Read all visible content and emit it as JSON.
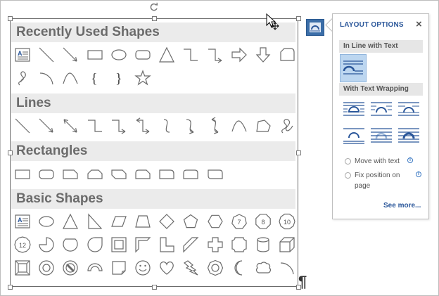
{
  "gallery": {
    "sections": [
      {
        "title": "Recently Used Shapes"
      },
      {
        "title": "Lines"
      },
      {
        "title": "Rectangles"
      },
      {
        "title": "Basic Shapes"
      }
    ],
    "recently_used": [
      "text-box",
      "line",
      "line-arrow",
      "rectangle",
      "oval",
      "rounded-rectangle",
      "triangle",
      "elbow-connector",
      "elbow-arrow-connector",
      "right-arrow",
      "down-arrow",
      "snip-corner",
      "freeform-scribble",
      "arc",
      "curve",
      "left-brace",
      "right-brace",
      "star"
    ],
    "lines": [
      "line",
      "line-arrow",
      "double-arrow-line",
      "elbow-connector",
      "elbow-arrow-connector",
      "elbow-double-arrow",
      "curved-connector",
      "curved-arrow-connector",
      "curved-double-arrow",
      "curve",
      "freeform",
      "scribble"
    ],
    "rectangles": [
      "rectangle",
      "rounded-rectangle",
      "snip-single-corner",
      "snip-same-side",
      "snip-diagonal",
      "snip-round-single",
      "round-single-corner",
      "round-same-side",
      "round-diagonal"
    ],
    "basic_row1": [
      "text-box",
      "oval",
      "triangle",
      "right-triangle",
      "parallelogram",
      "trapezoid",
      "diamond",
      "pentagon",
      "hexagon",
      "heptagon",
      "octagon",
      "decagon"
    ],
    "basic_row1_labels": [
      "",
      "",
      "",
      "",
      "",
      "",
      "",
      "",
      "",
      "7",
      "8",
      "10"
    ],
    "basic_row2": [
      "dodecagon",
      "pie",
      "chord",
      "teardrop",
      "frame",
      "half-frame",
      "l-shape",
      "diagonal-stripe",
      "cross",
      "plaque",
      "can",
      "cube"
    ],
    "basic_row2_labels": [
      "12",
      "",
      "",
      "",
      "",
      "",
      "",
      "",
      "",
      "",
      "",
      ""
    ],
    "basic_row3": [
      "bevel",
      "donut",
      "no-symbol",
      "block-arc",
      "folded-corner",
      "smiley-face",
      "heart",
      "lightning-bolt",
      "sun",
      "moon",
      "cloud",
      "arc"
    ]
  },
  "paragraph_mark": "¶",
  "layout_options": {
    "title": "LAYOUT OPTIONS",
    "close_icon": "×",
    "in_line_label": "In Line with Text",
    "wrapping_label": "With Text Wrapping",
    "wrap_styles": [
      "square",
      "tight",
      "through",
      "top-and-bottom",
      "behind-text",
      "in-front-of-text"
    ],
    "move_with_text": "Move with text",
    "fix_position": "Fix position on page",
    "info_glyph": "i",
    "see_more": "See more...",
    "accent_color": "#2b579a",
    "selected_bg": "#bcd6f0"
  }
}
